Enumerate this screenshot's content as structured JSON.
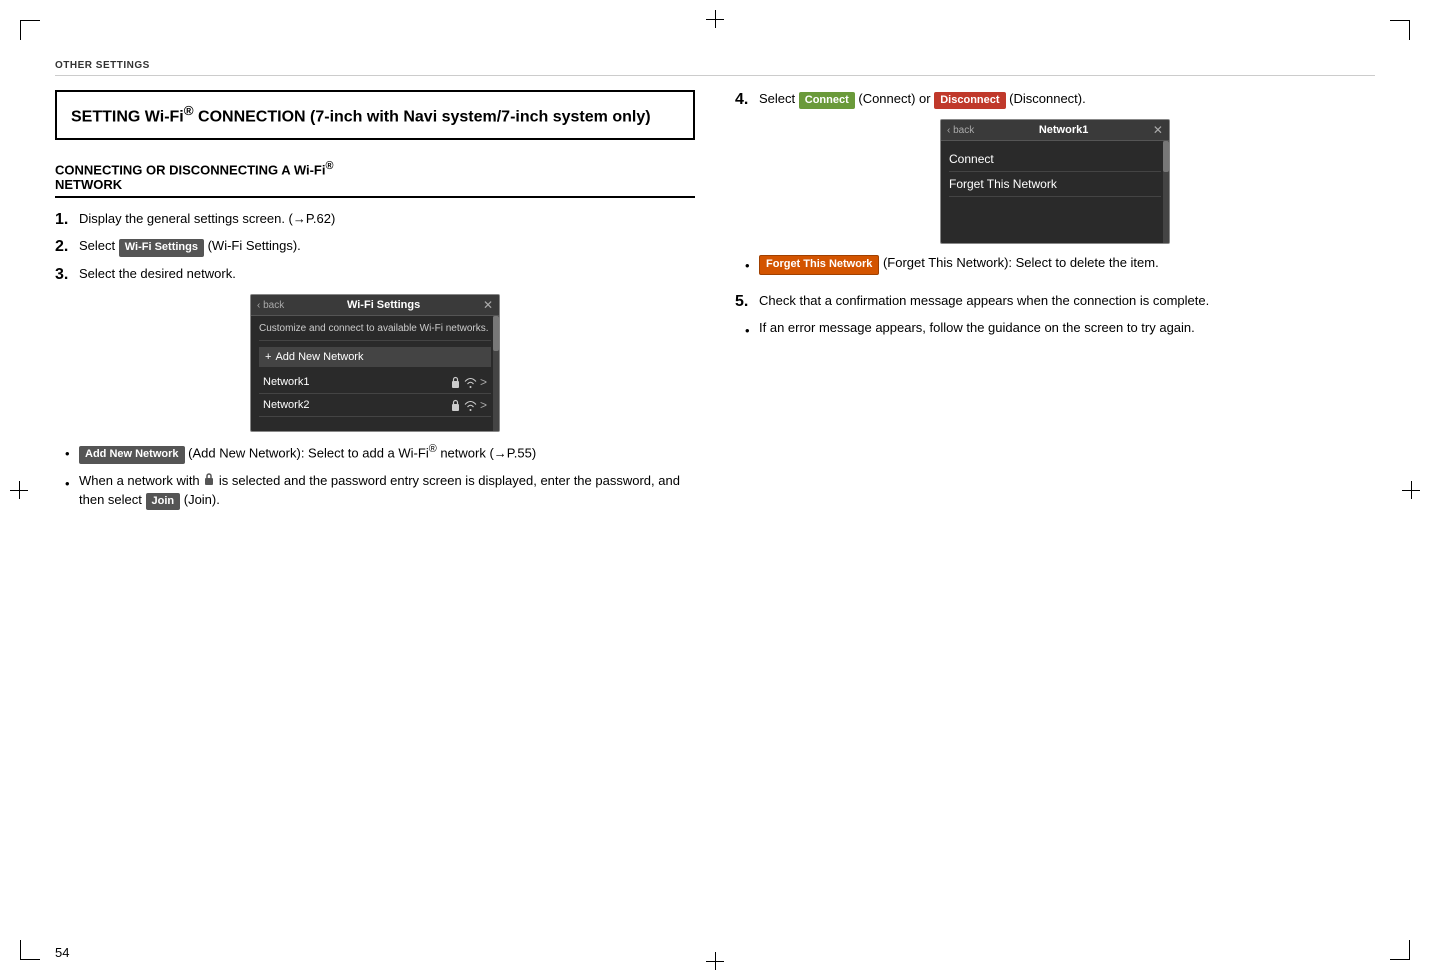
{
  "page": {
    "number": "54",
    "header_label": "OTHER SETTINGS"
  },
  "left_col": {
    "section_title_line1": "SETTING Wi-Fi",
    "section_title_sup": "®",
    "section_title_line2": " CONNECTION (7-inch with",
    "section_title_line3": "Navi system/7-inch system only)",
    "sub_heading": "CONNECTING OR DISCONNECTING A Wi-Fi® NETWORK",
    "steps": [
      {
        "number": "1.",
        "text": "Display the general settings screen. (→P.62)"
      },
      {
        "number": "2.",
        "text_before": "Select ",
        "button": "Wi-Fi Settings",
        "text_after": " (Wi-Fi Settings)."
      },
      {
        "number": "3.",
        "text": "Select the desired network."
      }
    ],
    "screenshot_wifi": {
      "title_bar_back": "< back",
      "title": "Wi-Fi Settings",
      "close": "×",
      "description": "Customize and connect to available Wi-Fi networks.",
      "add_network": "+ Add New Network",
      "networks": [
        {
          "name": "Network1",
          "lock": true,
          "wifi": true,
          "arrow": ">"
        },
        {
          "name": "Network2",
          "lock": true,
          "wifi": true,
          "arrow": ">"
        }
      ]
    },
    "bullets": [
      {
        "button": "Add New Network",
        "text": " (Add New Network): Select to add a Wi-Fi® network (→P.55)"
      },
      {
        "text_before": "When a network with ",
        "icon": "lock",
        "text_after": " is selected and the password entry screen is displayed, enter the password, and then select ",
        "button2": "Join",
        "text_end": " (Join)."
      }
    ]
  },
  "right_col": {
    "step4": {
      "number": "4.",
      "text_before": "Select ",
      "button_connect": "Connect",
      "text_middle": " (Connect) or ",
      "button_disconnect": "Disconnect",
      "text_after": " (Disconnect)."
    },
    "screenshot_network": {
      "title_bar_label": "< back",
      "title": "Network1",
      "close": "×",
      "options": [
        "Connect",
        "Forget This Network"
      ]
    },
    "bullets_step4": [
      {
        "button": "Forget This Network",
        "text": " (Forget This Network): Select to delete the item."
      }
    ],
    "step5": {
      "number": "5.",
      "text": "Check that a confirmation message appears when the connection is complete."
    },
    "bullets_step5": [
      {
        "text": "If an error message appears, follow the guidance on the screen to try again."
      }
    ]
  }
}
